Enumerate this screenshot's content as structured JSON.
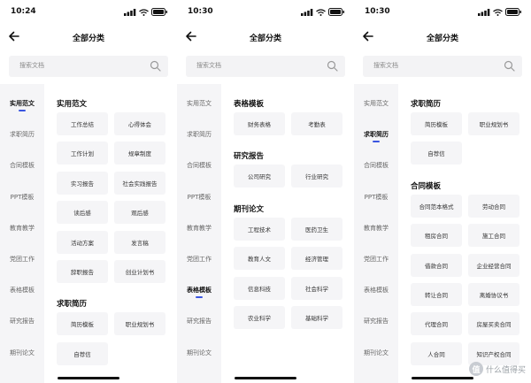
{
  "colors": {
    "accent": "#3a55e0",
    "sidebar_bg": "#f5f5f7",
    "chip_bg": "#f5f5f7"
  },
  "screens": [
    {
      "time": "10:24",
      "nav_title": "全部分类",
      "search_placeholder": "搜索文档",
      "sidebar": [
        "实用范文",
        "求职简历",
        "合同模板",
        "PPT模板",
        "教育教学",
        "党团工作",
        "表格模板",
        "研究报告",
        "期刊论文"
      ],
      "active_index": 0,
      "sections": [
        {
          "title": "实用范文",
          "items": [
            "工作总结",
            "心得体会",
            "工作计划",
            "规章制度",
            "实习报告",
            "社会实践报告",
            "读后感",
            "观后感",
            "活动方案",
            "发言稿",
            "辞职报告",
            "创业计划书"
          ]
        },
        {
          "title": "求职简历",
          "items": [
            "简历模板",
            "职业规划书",
            "自荐信"
          ]
        }
      ]
    },
    {
      "time": "10:30",
      "nav_title": "全部分类",
      "search_placeholder": "搜索文档",
      "sidebar": [
        "实用范文",
        "求职简历",
        "合同模板",
        "PPT模板",
        "教育教学",
        "党团工作",
        "表格模板",
        "研究报告",
        "期刊论文"
      ],
      "active_index": 6,
      "sections": [
        {
          "title": "表格模板",
          "items": [
            "财务表格",
            "考勤表"
          ]
        },
        {
          "title": "研究报告",
          "items": [
            "公司研究",
            "行业研究"
          ]
        },
        {
          "title": "期刊论文",
          "items": [
            "工程技术",
            "医药卫生",
            "教育人文",
            "经济管理",
            "信息科技",
            "社会科学",
            "农业科学",
            "基础科学"
          ]
        }
      ]
    },
    {
      "time": "10:30",
      "nav_title": "全部分类",
      "search_placeholder": "搜索文档",
      "sidebar": [
        "实用范文",
        "求职简历",
        "合同模板",
        "PPT模板",
        "教育教学",
        "党团工作",
        "表格模板",
        "研究报告",
        "期刊论文"
      ],
      "active_index": 1,
      "sections": [
        {
          "title": "求职简历",
          "items": [
            "简历模板",
            "职业规划书",
            "自荐信"
          ]
        },
        {
          "title": "合同模板",
          "items": [
            "合同范本格式",
            "劳动合同",
            "租房合同",
            "施工合同",
            "借款合同",
            "企业经营合同",
            "转让合同",
            "离婚协议书",
            "代理合同",
            "房屋买卖合同",
            "人合同",
            "知识产权合同"
          ]
        }
      ]
    }
  ],
  "watermark": {
    "badge": "值",
    "text": "什么值得买"
  }
}
